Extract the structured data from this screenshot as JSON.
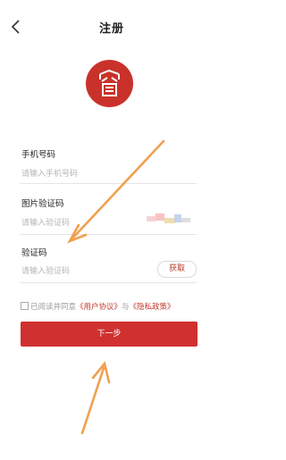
{
  "header": {
    "title": "注册",
    "back_icon": "chevron-left-icon"
  },
  "logo": {
    "icon": "seal-logo-icon",
    "color": "#c9322a"
  },
  "form": {
    "phone": {
      "label": "手机号码",
      "placeholder": "请输入手机号码"
    },
    "image_code": {
      "label": "图片验证码",
      "placeholder": "请输入验证码"
    },
    "sms_code": {
      "label": "验证码",
      "placeholder": "请输入验证码",
      "get_label": "获取"
    }
  },
  "agreement": {
    "prefix": "已阅读并同意",
    "user_agreement": "《用户协议》",
    "conjunction": "与",
    "privacy_policy": "《隐私政策》"
  },
  "next_button": {
    "label": "下一步"
  },
  "colors": {
    "accent": "#d03030",
    "annotation_arrow": "#f0a050"
  }
}
